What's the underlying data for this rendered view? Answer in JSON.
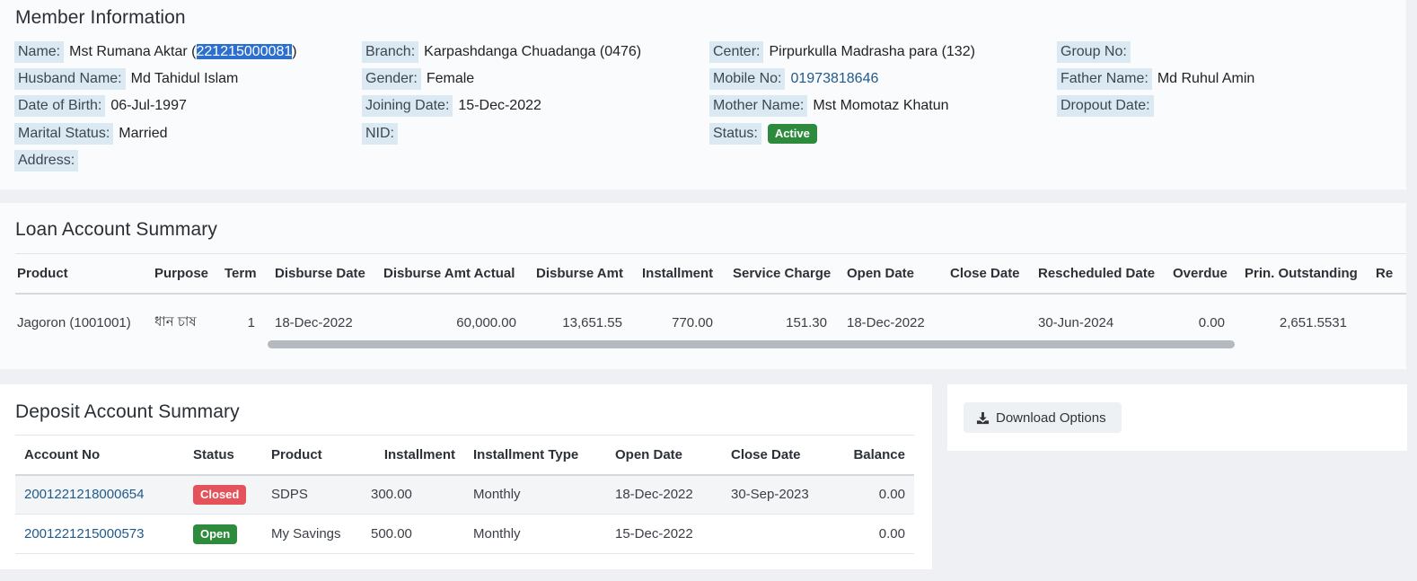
{
  "member": {
    "title": "Member Information",
    "name_label": "Name:",
    "name_value_prefix": "Mst Rumana Aktar (",
    "name_id": "221215000081",
    "name_value_suffix": ")",
    "branch_label": "Branch:",
    "branch_value": "Karpashdanga Chuadanga (0476)",
    "center_label": "Center:",
    "center_value": "Pirpurkulla Madrasha para (132)",
    "group_label": "Group No:",
    "group_value": "",
    "husband_label": "Husband Name:",
    "husband_value": "Md Tahidul Islam",
    "gender_label": "Gender:",
    "gender_value": "Female",
    "mobile_label": "Mobile No:",
    "mobile_value": "01973818646",
    "father_label": "Father Name:",
    "father_value": "Md Ruhul Amin",
    "dob_label": "Date of Birth:",
    "dob_value": "06-Jul-1997",
    "joining_label": "Joining Date:",
    "joining_value": "15-Dec-2022",
    "mother_label": "Mother Name:",
    "mother_value": "Mst Momotaz Khatun",
    "dropout_label": "Dropout Date:",
    "dropout_value": "",
    "marital_label": "Marital Status:",
    "marital_value": "Married",
    "nid_label": "NID:",
    "nid_value": "",
    "status_label": "Status:",
    "status_value": "Active",
    "address_label": "Address:",
    "address_value": ""
  },
  "loan": {
    "title": "Loan Account Summary",
    "headers": [
      "Product",
      "Purpose",
      "Term",
      "Disburse Date",
      "Disburse Amt Actual",
      "Disburse Amt",
      "Installment",
      "Service Charge",
      "Open Date",
      "Close Date",
      "Rescheduled Date",
      "Overdue",
      "Prin. Outstanding",
      "Re"
    ],
    "rows": [
      [
        "Jagoron (1001001)",
        "ধান চাষ",
        "1",
        "18-Dec-2022",
        "60,000.00",
        "13,651.55",
        "770.00",
        "151.30",
        "18-Dec-2022",
        "",
        "30-Jun-2024",
        "0.00",
        "2,651.5531",
        ""
      ]
    ]
  },
  "deposit": {
    "title": "Deposit Account Summary",
    "headers": [
      "Account No",
      "Status",
      "Product",
      "Installment",
      "Installment Type",
      "Open Date",
      "Close Date",
      "Balance"
    ],
    "rows": [
      {
        "account": "2001221218000654",
        "status": "Closed",
        "product": "SDPS",
        "installment": "300.00",
        "type": "Monthly",
        "open": "18-Dec-2022",
        "close": "30-Sep-2023",
        "balance": "0.00"
      },
      {
        "account": "2001221215000573",
        "status": "Open",
        "product": "My Savings",
        "installment": "500.00",
        "type": "Monthly",
        "open": "15-Dec-2022",
        "close": "",
        "balance": "0.00"
      }
    ]
  },
  "download": {
    "label": "Download Options",
    "icon": "download-icon"
  },
  "colors": {
    "label_bg": "#dbe9f3",
    "active_green": "#2e8b3d",
    "closed_red": "#e4525a",
    "link_blue": "#1f5a8c"
  }
}
